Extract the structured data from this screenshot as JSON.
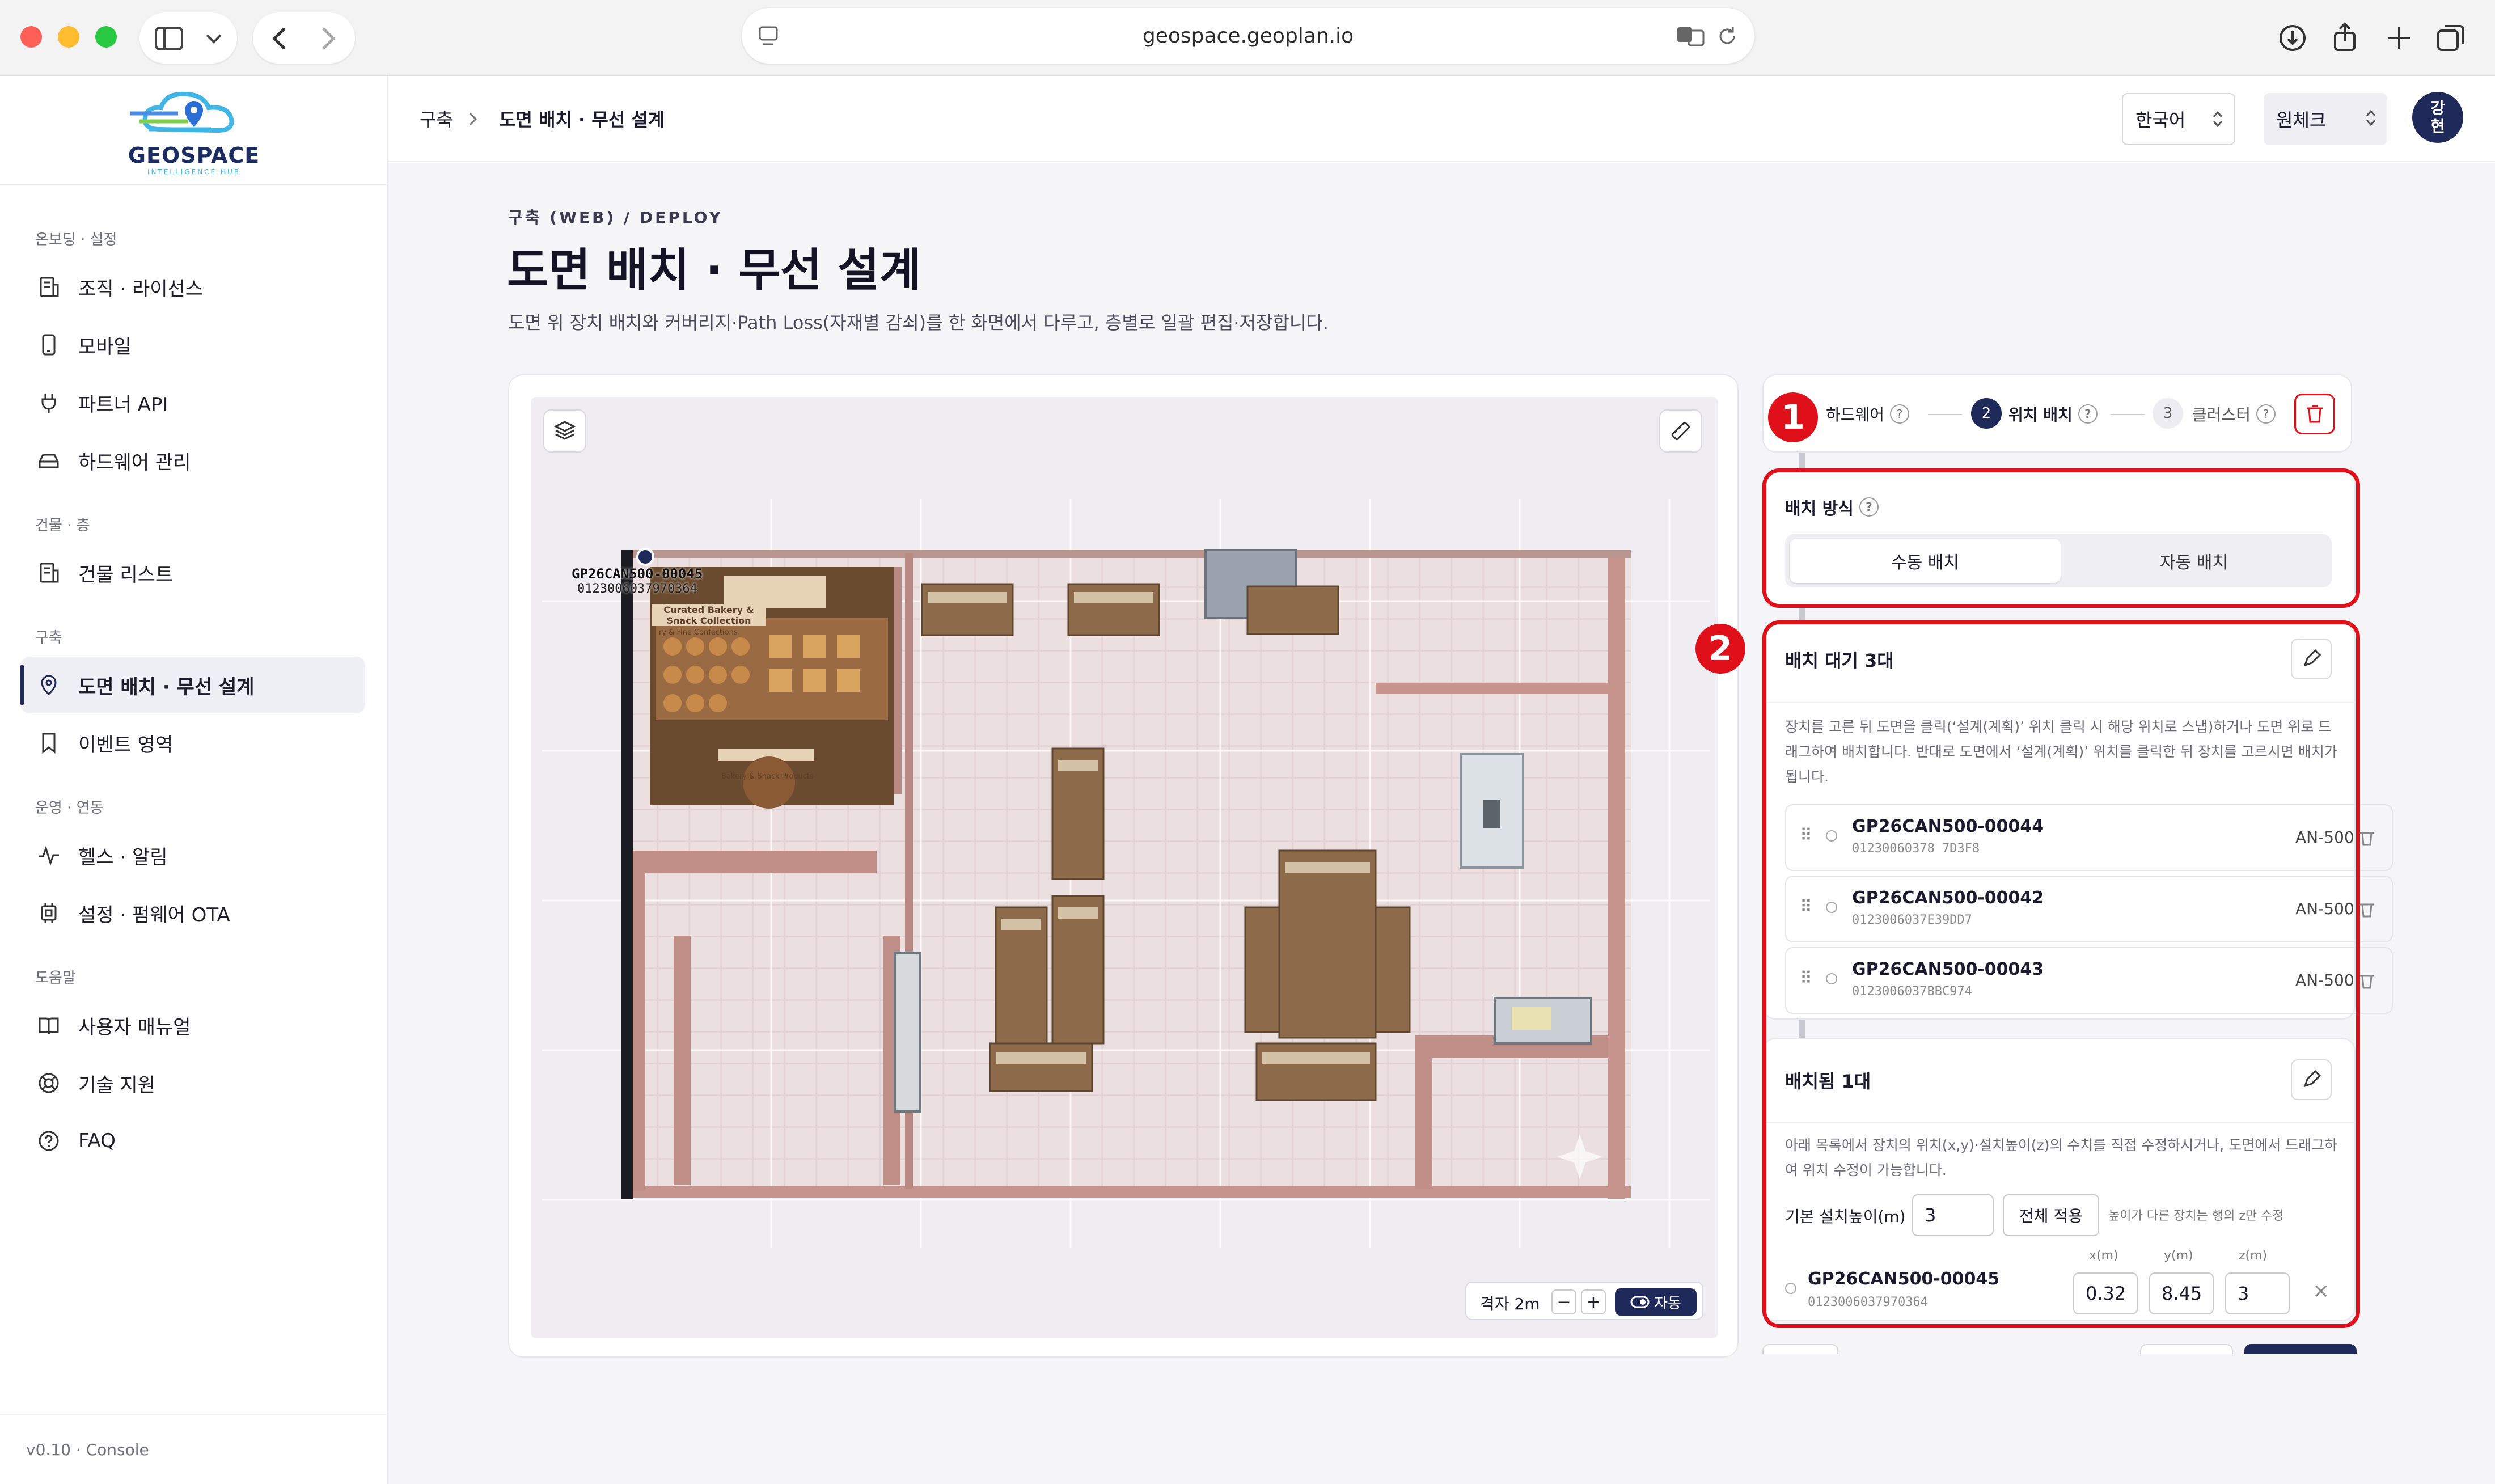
{
  "browser": {
    "url": "geospace.geoplan.io"
  },
  "logo": {
    "name": "GEOSPACE",
    "tagline": "INTELLIGENCE HUB"
  },
  "sidebar": {
    "sections": [
      {
        "label": "온보딩 · 설정",
        "items": [
          {
            "label": "조직 · 라이선스",
            "icon": "building-icon"
          },
          {
            "label": "모바일",
            "icon": "mobile-icon"
          },
          {
            "label": "파트너 API",
            "icon": "plug-icon"
          },
          {
            "label": "하드웨어 관리",
            "icon": "hardware-icon"
          }
        ]
      },
      {
        "label": "건물 · 층",
        "items": [
          {
            "label": "건물 리스트",
            "icon": "building-list-icon"
          }
        ]
      },
      {
        "label": "구축",
        "items": [
          {
            "label": "도면 배치 · 무선 설계",
            "icon": "location-pin-icon",
            "active": true
          },
          {
            "label": "이벤트 영역",
            "icon": "bookmark-icon"
          }
        ]
      },
      {
        "label": "운영 · 연동",
        "items": [
          {
            "label": "헬스 · 알림",
            "icon": "pulse-icon"
          },
          {
            "label": "설정 · 펌웨어 OTA",
            "icon": "chip-icon"
          }
        ]
      },
      {
        "label": "도움말",
        "items": [
          {
            "label": "사용자 매뉴얼",
            "icon": "book-icon"
          },
          {
            "label": "기술 지원",
            "icon": "lifebuoy-icon"
          },
          {
            "label": "FAQ",
            "icon": "help-circle-icon"
          }
        ]
      }
    ],
    "version": "v0.10 · Console"
  },
  "topbar": {
    "breadcrumb": [
      "구축",
      "도면 배치 · 무선 설계"
    ],
    "language": "한국어",
    "org": "원체크",
    "avatar": "강\n현"
  },
  "page": {
    "eyebrow": "구축 (WEB) / DEPLOY",
    "title": "도면 배치 · 무선 설계",
    "description": "도면 위 장치 배치와 커버리지·Path Loss(자재별 감쇠)를 한 화면에서 다루고, 층별로 일괄 편집·저장합니다."
  },
  "map": {
    "device_label": "GP26CAN500-00045",
    "device_id": "0123006037970364",
    "grid_label": "격자 2m",
    "auto_label": "자동",
    "store_signs": [
      "Curated Bakery & Snack Collection",
      "Bakery & Snack Products",
      "ry & Fine Confections"
    ]
  },
  "stepper": {
    "steps": [
      {
        "num": "1",
        "label": "하드웨어"
      },
      {
        "num": "2",
        "label": "위치 배치",
        "active": true
      },
      {
        "num": "3",
        "label": "클러스터"
      }
    ]
  },
  "annotations": {
    "badge1": "1",
    "badge2": "2"
  },
  "placement_mode": {
    "title": "배치 방식",
    "options": [
      "수동 배치",
      "자동 배치"
    ],
    "selected": "수동 배치"
  },
  "waiting": {
    "title": "배치 대기 3대",
    "help": "장치를 고른 뒤 도면을 클릭(‘설계(계획)’ 위치 클릭 시 해당 위치로 스냅)하거나 도면 위로 드래그하여 배치합니다. 반대로 도면에서 ‘설계(계획)’ 위치를 클릭한 뒤 장치를 고르시면 배치가 됩니다.",
    "devices": [
      {
        "name": "GP26CAN500-00044",
        "id": "01230060378 7D3F8",
        "model": "AN-500"
      },
      {
        "name": "GP26CAN500-00042",
        "id": "0123006037E39DD7",
        "model": "AN-500"
      },
      {
        "name": "GP26CAN500-00043",
        "id": "0123006037BBC974",
        "model": "AN-500"
      }
    ]
  },
  "placed": {
    "title": "배치됨 1대",
    "help": "아래 목록에서 장치의 위치(x,y)·설치높이(z)의 수치를 직접 수정하시거나, 도면에서 드래그하여 위치 수정이 가능합니다.",
    "height_label": "기본 설치높이(m)",
    "height_value": "3",
    "apply_all": "전체 적용",
    "height_note": "높이가 다른 장치는 행의 z만 수정",
    "columns": [
      "x(m)",
      "y(m)",
      "z(m)"
    ],
    "device": {
      "name": "GP26CAN500-00045",
      "id": "0123006037970364",
      "x": "0.32",
      "y": "8.45",
      "z": "3"
    }
  },
  "colors": {
    "accent": "#1f2a5a",
    "red": "#e0101a"
  }
}
